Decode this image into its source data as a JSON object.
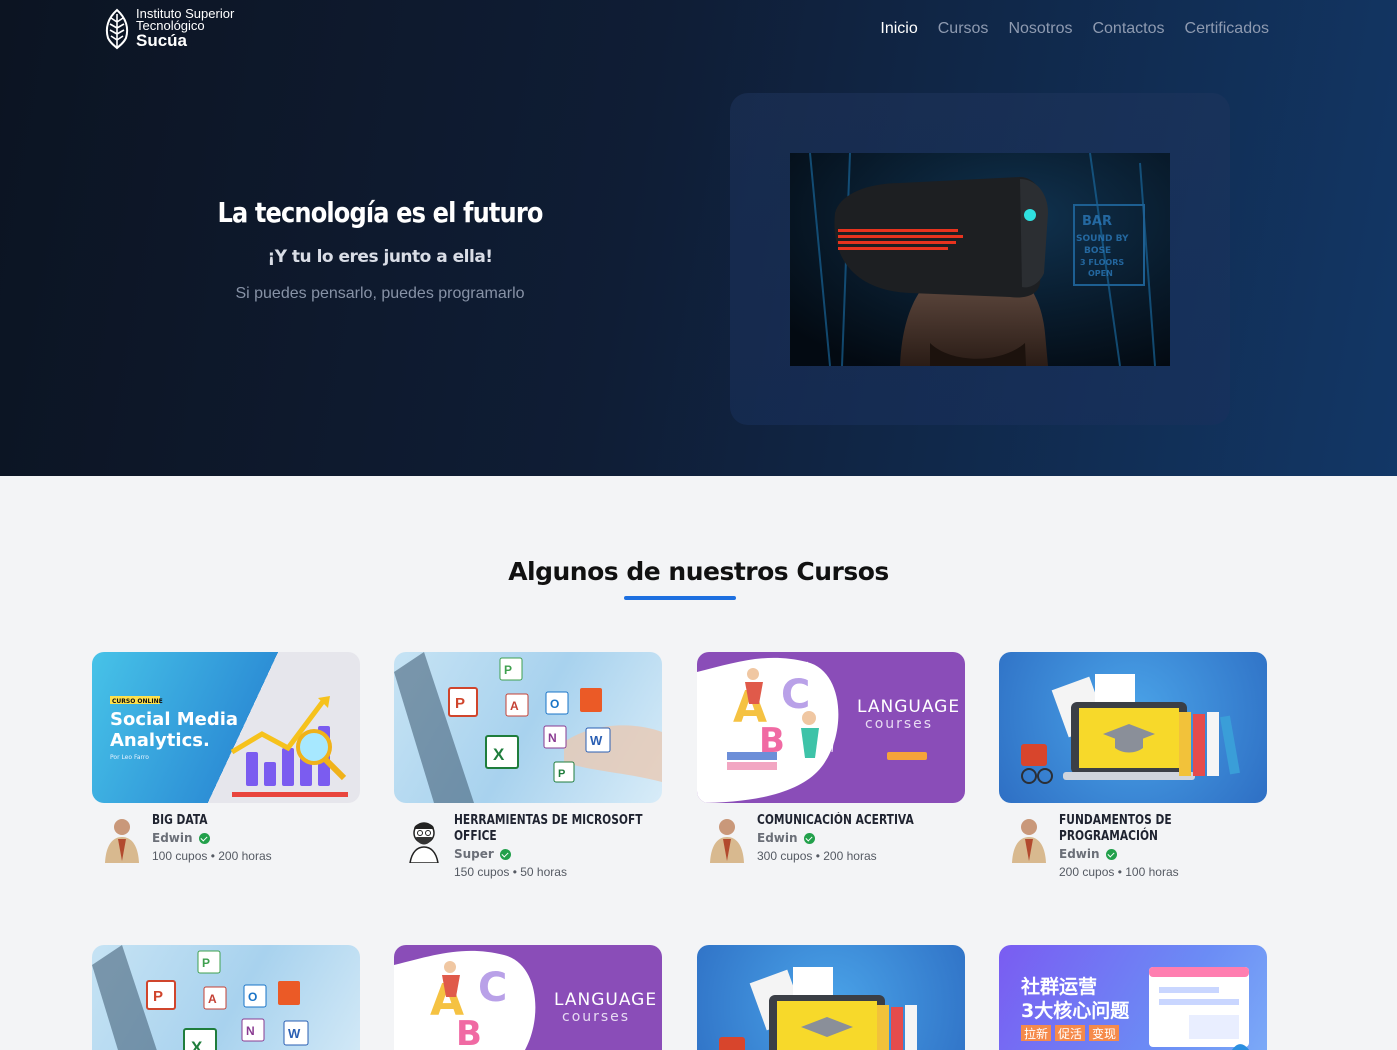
{
  "logo": {
    "line1": "Instituto Superior",
    "line2": "Tecnológico",
    "name": "Sucúa"
  },
  "nav": {
    "items": [
      "Inicio",
      "Cursos",
      "Nosotros",
      "Contactos",
      "Certificados"
    ],
    "active": "Inicio"
  },
  "hero": {
    "title": "La tecnología es el futuro",
    "subtitle": "¡Y tu lo eres junto a ella!",
    "tagline": "Si puedes pensarlo, puedes programarlo",
    "image_sign": [
      "BAR",
      "SOUND BY",
      "BOSE",
      "3 FLOORS",
      "OPEN"
    ]
  },
  "section": {
    "title": "Algunos de nuestros Cursos"
  },
  "courses": [
    {
      "title": "BIG DATA",
      "author": "Edwin",
      "stats": "100 cupos • 200 horas",
      "thumb": {
        "badge": "CURSO ONLINE",
        "line1": "Social Media",
        "line2": "Analytics.",
        "by": "Por Leo Farro"
      }
    },
    {
      "title": "HERRAMIENTAS DE MICROSOFT OFFICE",
      "author": "Super",
      "stats": "150 cupos • 50 horas"
    },
    {
      "title": "COMUNICACIÓN ACERTIVA",
      "author": "Edwin",
      "stats": "300 cupos • 200 horas",
      "thumb": {
        "line1": "LANGUAGE",
        "line2": "courses"
      }
    },
    {
      "title": "FUNDAMENTOS DE PROGRAMACIÓN",
      "author": "Edwin",
      "stats": "200 cupos • 100 horas"
    }
  ],
  "row2": {
    "language": {
      "line1": "LANGUAGE",
      "line2": "courses"
    },
    "chinese": {
      "line1": "社群运营",
      "line2": "3大核心问题",
      "tags": [
        "拉新",
        "促活",
        "变现"
      ]
    }
  }
}
